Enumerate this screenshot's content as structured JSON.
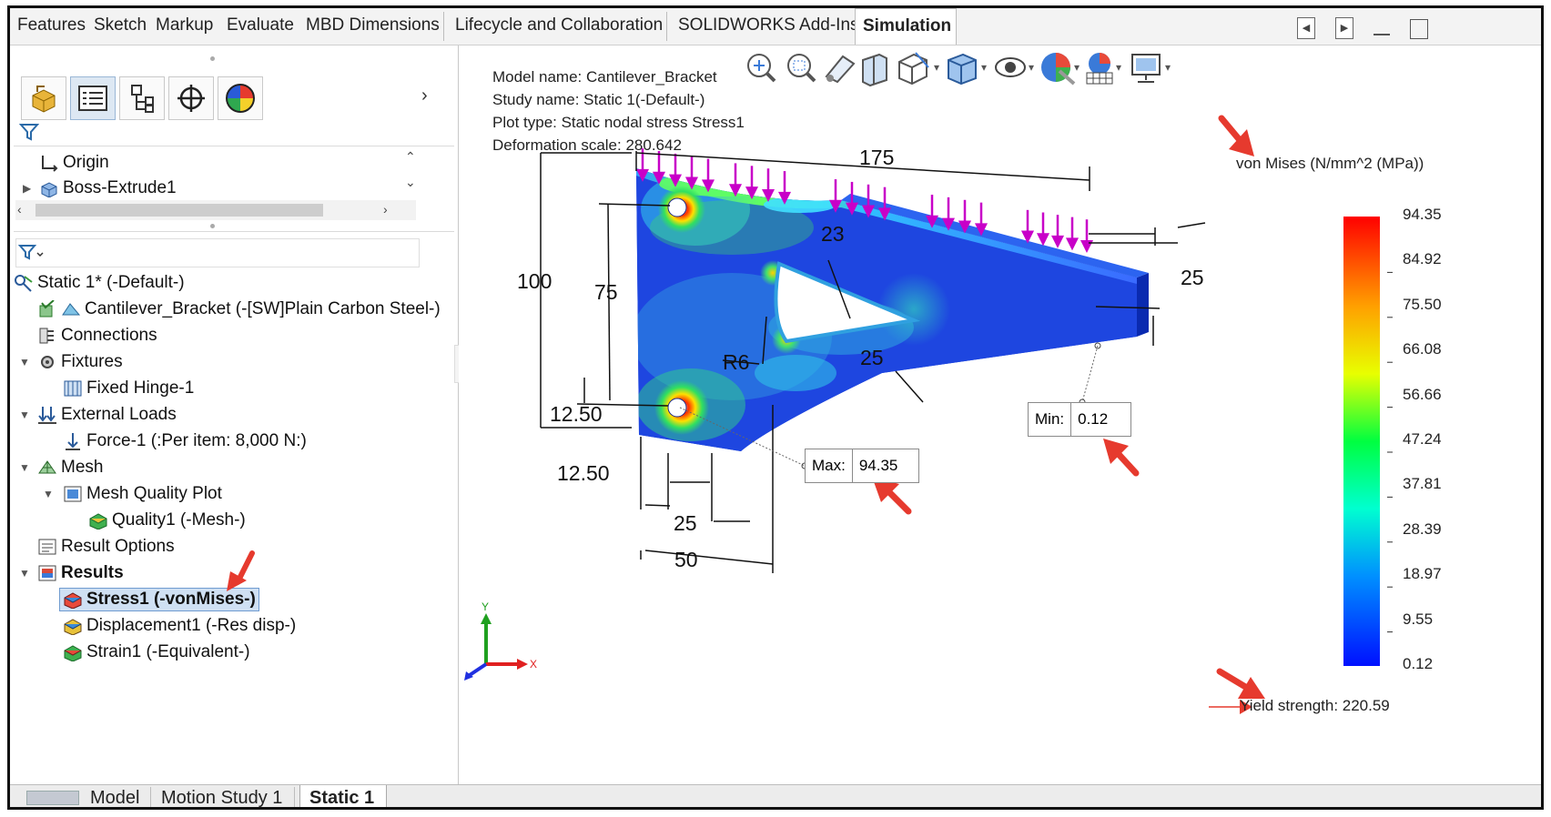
{
  "tabs": {
    "items": [
      "Features",
      "Sketch",
      "Markup",
      "Evaluate",
      "MBD Dimensions",
      "Lifecycle and Collaboration",
      "SOLIDWORKS Add-Ins",
      "Simulation"
    ],
    "active": "Simulation"
  },
  "tree": {
    "origin": "Origin",
    "boss": "Boss-Extrude1",
    "study": "Static 1* (-Default-)",
    "part": "Cantilever_Bracket (-[SW]Plain Carbon Steel-)",
    "connections": "Connections",
    "fixtures": "Fixtures",
    "fixed_hinge": "Fixed Hinge-1",
    "external_loads": "External Loads",
    "force": "Force-1 (:Per item: 8,000 N:)",
    "mesh": "Mesh",
    "mesh_quality_plot": "Mesh Quality Plot",
    "quality1": "Quality1 (-Mesh-)",
    "result_options": "Result Options",
    "results": "Results",
    "stress1": "Stress1 (-vonMises-)",
    "displacement1": "Displacement1 (-Res disp-)",
    "strain1": "Strain1 (-Equivalent-)"
  },
  "bottom_tabs": [
    "Model",
    "Motion Study 1",
    "Static 1"
  ],
  "info": {
    "model_name": "Model name: Cantilever_Bracket",
    "study_name": "Study name: Static 1(-Default-)",
    "plot_type": "Plot type: Static nodal stress Stress1",
    "deformation": "Deformation scale: 280.642"
  },
  "dimensions": {
    "d175": "175",
    "d23": "23",
    "d25a": "25",
    "d100": "100",
    "d75": "75",
    "r6": "R6",
    "d25b": "25",
    "d12_50a": "12.50",
    "d12_50b": "12.50",
    "d25c": "25",
    "d50": "50"
  },
  "probes": {
    "max_label": "Max:",
    "max_value": "94.35",
    "min_label": "Min:",
    "min_value": "0.12"
  },
  "legend": {
    "title": "von Mises (N/mm^2 (MPa))",
    "values": [
      "94.35",
      "84.92",
      "75.50",
      "66.08",
      "56.66",
      "47.24",
      "37.81",
      "28.39",
      "18.97",
      "9.55",
      "0.12"
    ],
    "yield": "Yield strength: 220.59"
  },
  "triad": {
    "x": "X",
    "y": "Y"
  },
  "colors": {
    "arrow": "#e63a2e",
    "load": "#c800c8",
    "accent": "#6f9bd0"
  }
}
